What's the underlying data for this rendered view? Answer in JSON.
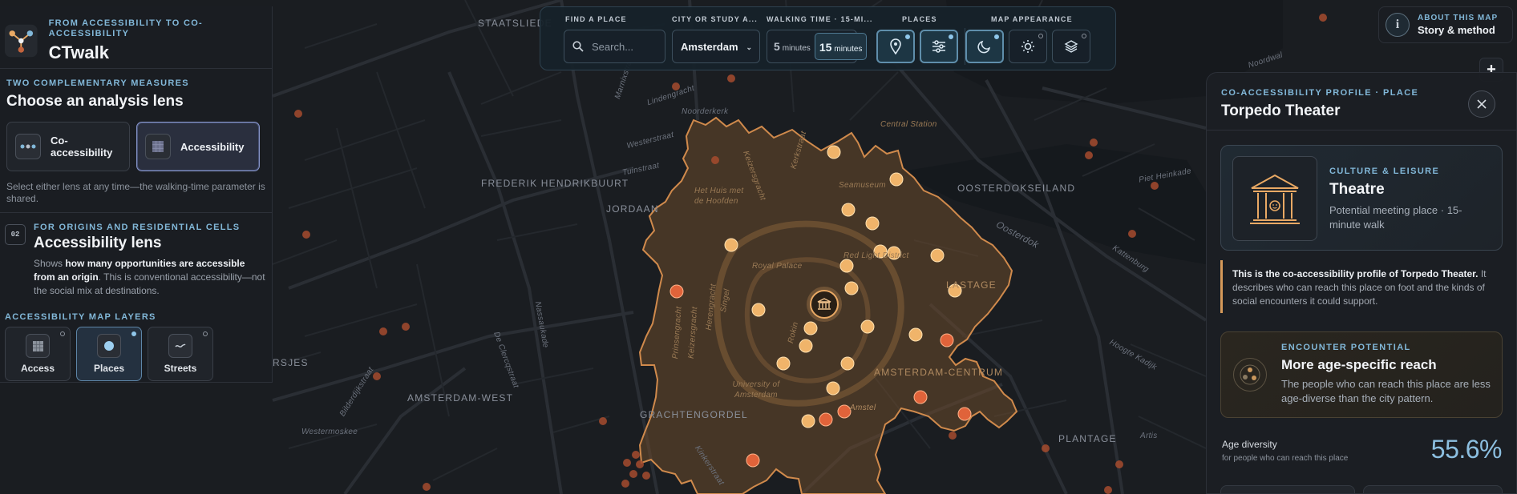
{
  "app": {
    "brand_subtitle": "FROM ACCESSIBILITY TO CO-ACCESSIBILITY",
    "brand_title": "CTwalk"
  },
  "lens": {
    "eyebrow": "TWO COMPLEMENTARY MEASURES",
    "title": "Choose an analysis lens",
    "options": [
      {
        "label": "Co-accessibility",
        "icon": "co-accessibility-icon",
        "active": false
      },
      {
        "label": "Accessibility",
        "icon": "grid-icon",
        "active": true
      }
    ],
    "note": "Select either lens at any time—the walking-time parameter is shared."
  },
  "accessibility_lens": {
    "number": "02",
    "eyebrow": "FOR ORIGINS AND RESIDENTIAL CELLS",
    "title": "Accessibility lens",
    "desc_prefix": "Shows ",
    "desc_bold": "how many opportunities are accessible from an origin",
    "desc_suffix": ". This is conventional accessibility—not the social mix at destinations.",
    "layers_title": "ACCESSIBILITY MAP LAYERS",
    "layers": [
      {
        "label": "Access",
        "icon": "grid-icon",
        "active": false
      },
      {
        "label": "Places",
        "icon": "dot-icon",
        "active": true
      },
      {
        "label": "Streets",
        "icon": "street-icon",
        "active": false
      }
    ]
  },
  "toolbar": {
    "find_label": "FIND A PLACE",
    "search_placeholder": "Search...",
    "city_label": "CITY OR STUDY A...",
    "city_value": "Amsterdam",
    "walk_label": "WALKING TIME · 15-MI...",
    "walk_options": [
      {
        "value": "5",
        "unit": "minutes",
        "active": false
      },
      {
        "value": "15",
        "unit": "minutes",
        "active": true
      }
    ],
    "places_label": "PLACES",
    "appearance_label": "MAP APPEARANCE",
    "buttons": [
      "location-pin-icon",
      "filter-sliders-icon",
      "moon-icon",
      "sun-icon",
      "layers-icon"
    ]
  },
  "about": {
    "subtitle": "ABOUT THIS MAP",
    "title": "Story & method"
  },
  "zoom_in_label": "+",
  "profile": {
    "eyebrow": "CO-ACCESSIBILITY PROFILE · PLACE",
    "title": "Torpedo Theater",
    "type_eyebrow": "CULTURE & LEISURE",
    "type_title": "Theatre",
    "type_desc": "Potential meeting place · 15-minute walk",
    "note_bold": "This is the co-accessibility profile of Torpedo Theater.",
    "note_rest": " It describes who can reach this place on foot and the kinds of social encounters it could support.",
    "encounter_eyebrow": "ENCOUNTER POTENTIAL",
    "encounter_title": "More age-specific reach",
    "encounter_desc": "The people who can reach this place are less age-diverse than the city pattern.",
    "diversity_label": "Age diversity",
    "diversity_sub": "for people who can reach this place",
    "diversity_value": "55.6%"
  },
  "map": {
    "labels": [
      "STAATSLIEDE",
      "Lindengracht",
      "Noorderkerk",
      "Westerstraat",
      "Tuinstraat",
      "FREDERIK HENDRIKBUURT",
      "JORDAAN",
      "Marnixstraat",
      "Nassaukade",
      "De Clercqstraat",
      "Bilderdijkstraat",
      "Westermoskee",
      "RSJES",
      "AMSTERDAM-WEST",
      "GRACHTENGORDEL",
      "Kinkerstraat",
      "Noordwal",
      "OOSTERDOKSEILAND",
      "Oosterdok",
      "Piet Heinkade",
      "Kattenburg",
      "Hoogte Kadijk",
      "PLANTAGE",
      "Artis",
      "Central Station",
      "Seamuseum",
      "Het Huis met de Hoofden",
      "Royal Palace",
      "Red Light District",
      "LASTAGE",
      "AMSTERDAM-CENTRUM",
      "University of Amsterdam",
      "Amstel",
      "Rokin",
      "Singel",
      "Herengracht",
      "Keizersgracht",
      "Prinsengracht",
      "Kerkstraat",
      "Keizersgracht"
    ],
    "accent_color": "#e9a964",
    "outside_point_color": "#c3643d",
    "selected_place_icon": "theatre-icon"
  }
}
